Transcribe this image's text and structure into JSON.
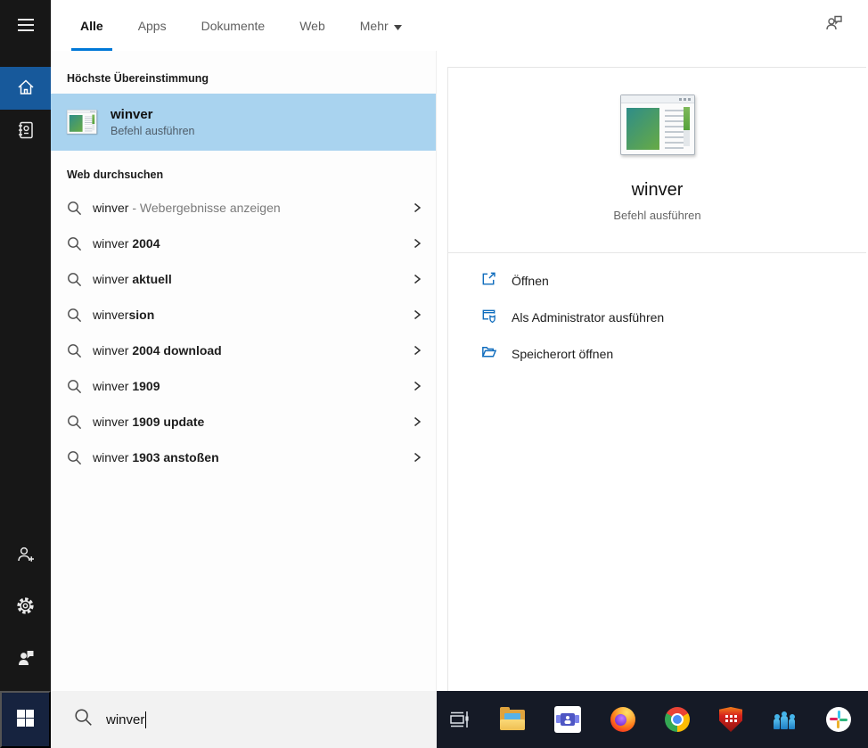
{
  "topbar": {
    "tabs": [
      {
        "label": "Alle",
        "active": true
      },
      {
        "label": "Apps",
        "active": false
      },
      {
        "label": "Dokumente",
        "active": false
      },
      {
        "label": "Web",
        "active": false
      },
      {
        "label": "Mehr",
        "active": false,
        "has_dropdown": true
      }
    ]
  },
  "left_panel": {
    "best_match_header": "Höchste Übereinstimmung",
    "best_match": {
      "title": "winver",
      "subtitle": "Befehl ausführen"
    },
    "web_header": "Web durchsuchen",
    "suggestions": [
      {
        "normal": "winver",
        "bold": "",
        "gray": " - Webergebnisse anzeigen"
      },
      {
        "normal": "winver ",
        "bold": "2004",
        "gray": ""
      },
      {
        "normal": "winver ",
        "bold": "aktuell",
        "gray": ""
      },
      {
        "normal": "winver",
        "bold": "sion",
        "gray": ""
      },
      {
        "normal": "winver ",
        "bold": "2004 download",
        "gray": ""
      },
      {
        "normal": "winver ",
        "bold": "1909",
        "gray": ""
      },
      {
        "normal": "winver ",
        "bold": "1909 update",
        "gray": ""
      },
      {
        "normal": "winver ",
        "bold": "1903 anstoßen",
        "gray": ""
      }
    ]
  },
  "preview": {
    "title": "winver",
    "subtitle": "Befehl ausführen",
    "actions": [
      {
        "label": "Öffnen",
        "icon": "open-icon"
      },
      {
        "label": "Als Administrator ausführen",
        "icon": "admin-shield-icon"
      },
      {
        "label": "Speicherort öffnen",
        "icon": "open-folder-icon"
      }
    ]
  },
  "search_bar": {
    "value": "winver"
  },
  "taskbar": {
    "icons": [
      "task-view",
      "file-explorer",
      "teams",
      "firefox",
      "chrome",
      "security-shield",
      "collaboration-people",
      "slack"
    ]
  },
  "colors": {
    "accent": "#0078d7",
    "selection": "#a9d3ef",
    "sidebar_active": "#17599b",
    "sidebar_bg": "#171717",
    "taskbar_bg": "#151a26",
    "start_bg": "#16233f",
    "action_icon_blue": "#0f6cbd"
  }
}
